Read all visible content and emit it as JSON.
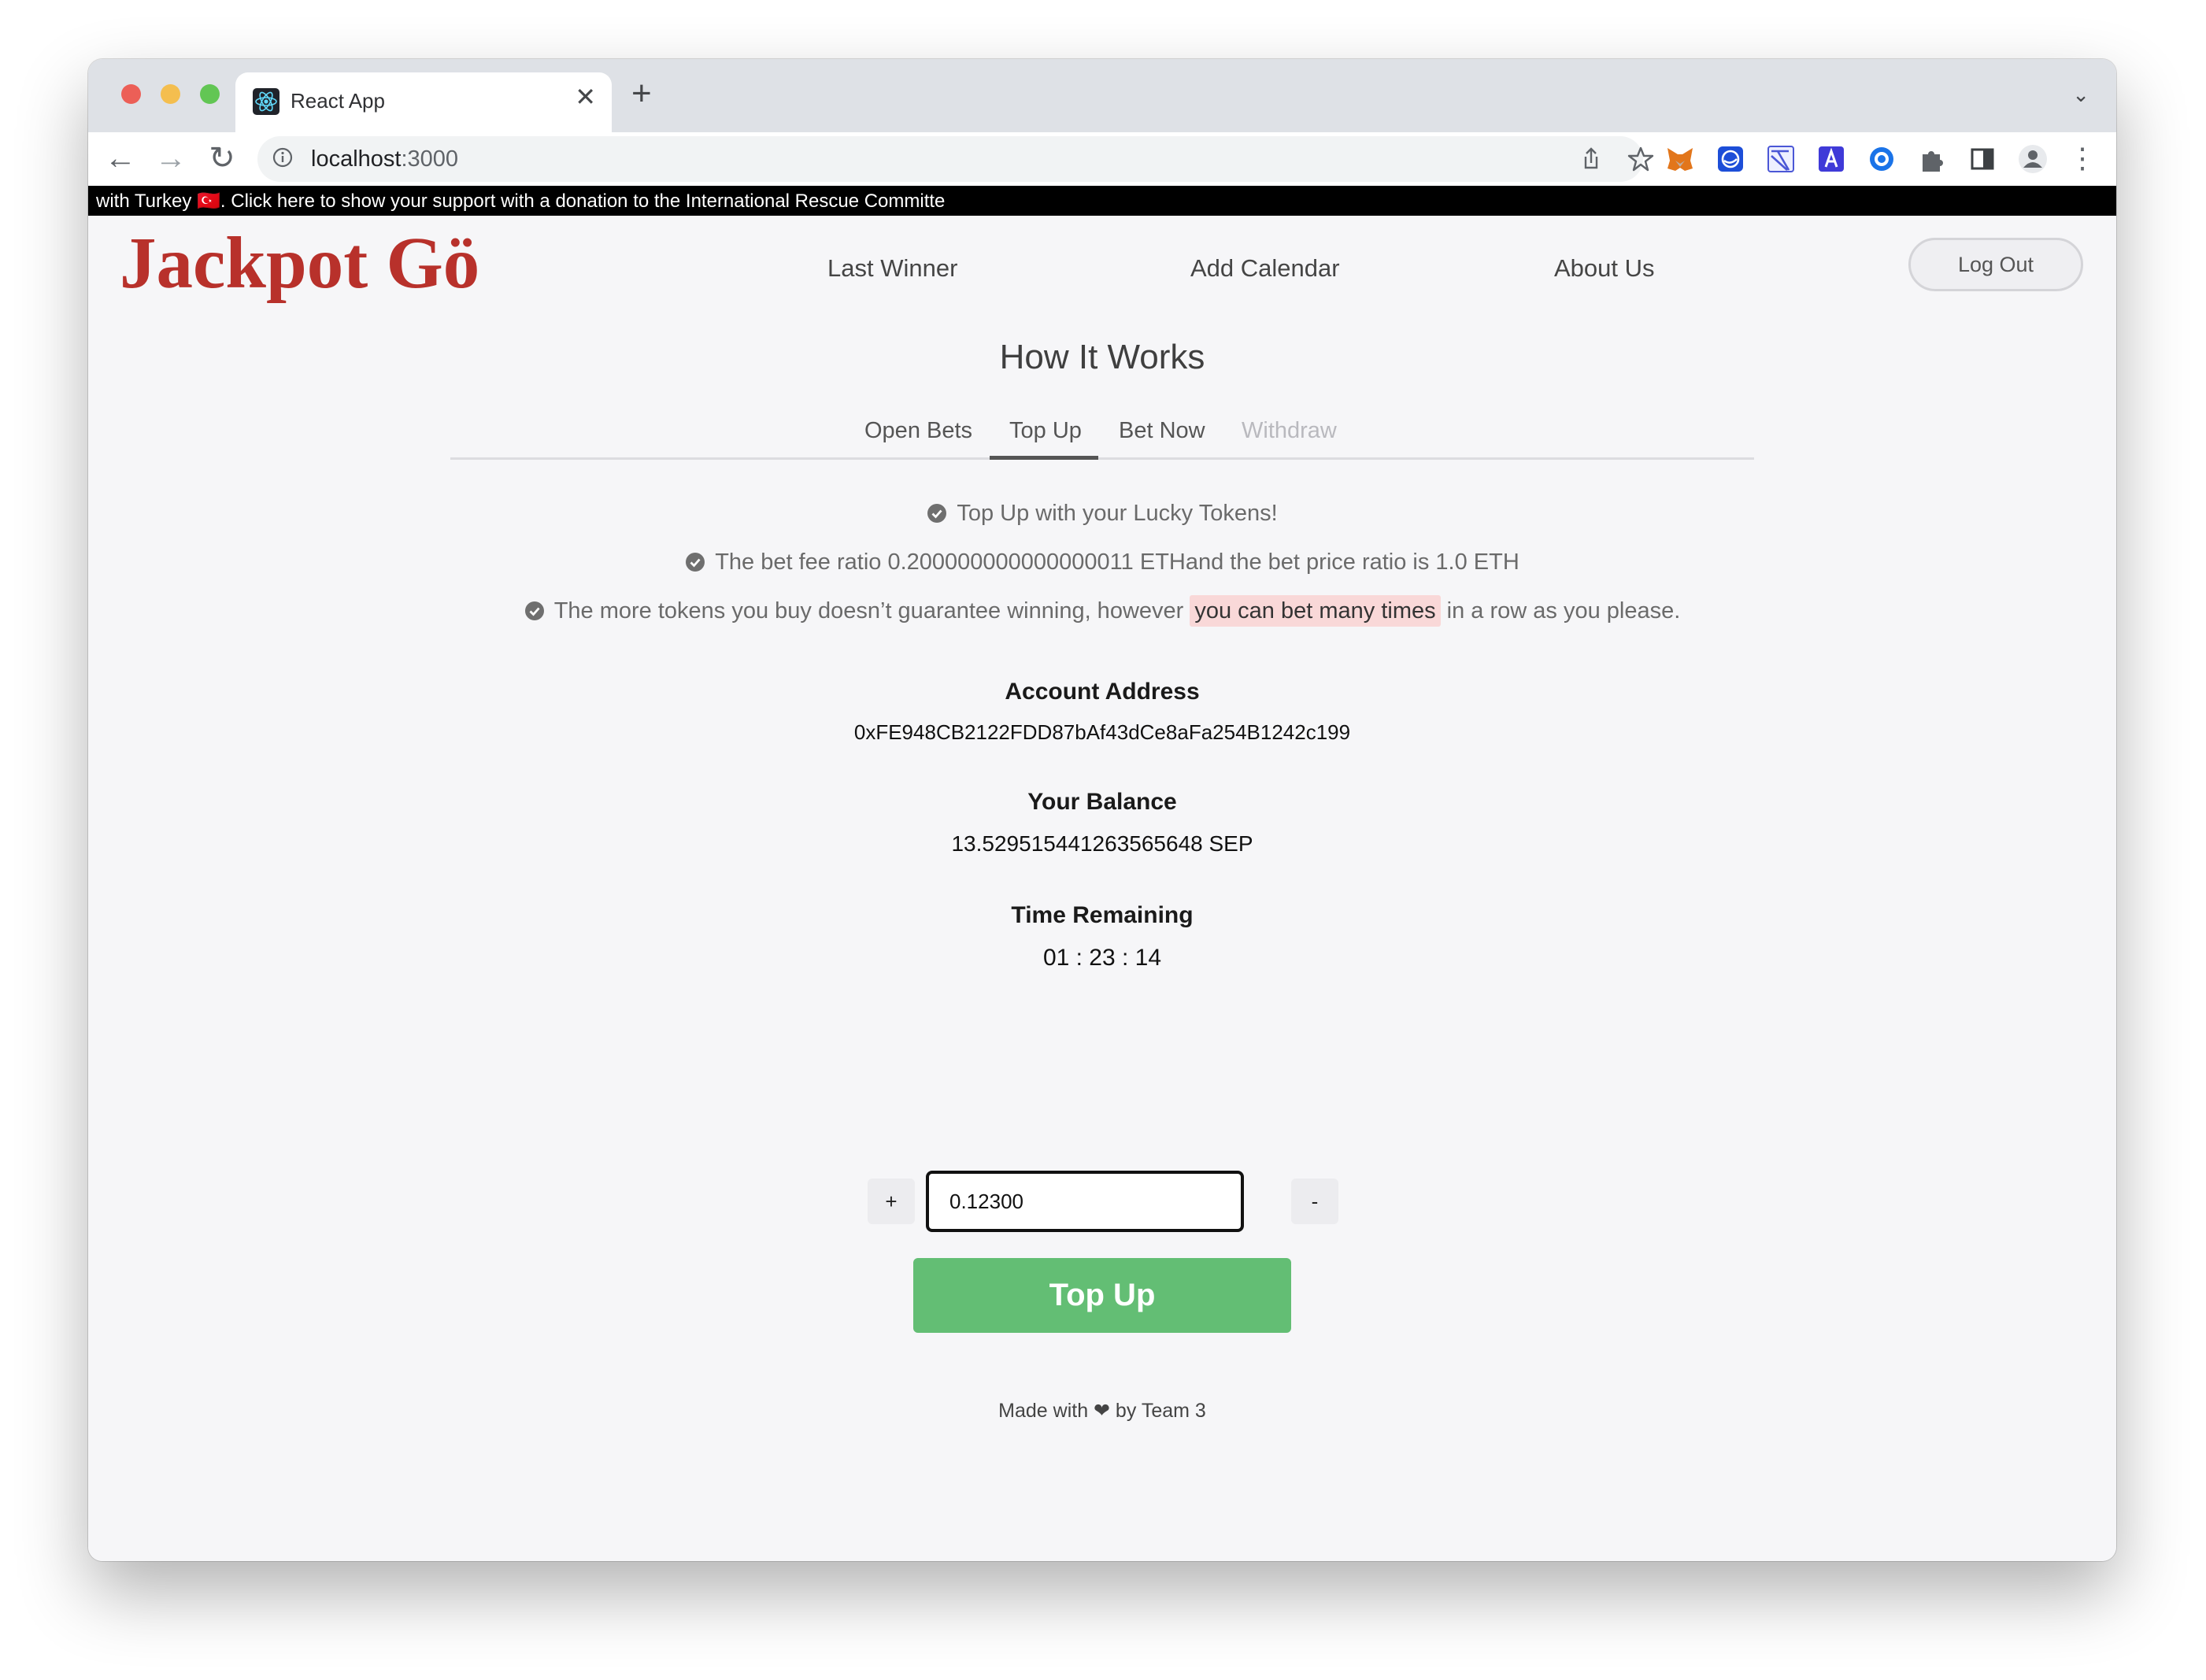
{
  "browser": {
    "tab_title": "React App",
    "tab_close": "✕",
    "new_tab": "+",
    "tab_list": "⌄",
    "url_host": "localhost",
    "url_port": ":3000",
    "nav_back": "←",
    "nav_forward": "→",
    "nav_reload": "↻",
    "menu": "⋮"
  },
  "ticker": {
    "text": "with Turkey 🇹🇷. Click here to show your support with a donation to the International Rescue Committe"
  },
  "header": {
    "logo": "Jackpot Gö",
    "nav": [
      "Last Winner",
      "Add Calendar",
      "About Us"
    ],
    "logout_label": "Log Out"
  },
  "main": {
    "title": "How It Works",
    "tabs": [
      "Open Bets",
      "Top Up",
      "Bet Now",
      "Withdraw"
    ],
    "active_tab": "Top Up",
    "features": {
      "line1": "Top Up with your Lucky Tokens!",
      "line2": "The bet fee ratio 0.200000000000000011 ETHand the bet price ratio is 1.0 ETH",
      "line3_before": "The more tokens you buy doesn’t guarantee winning, however ",
      "line3_highlight": "you can bet many times",
      "line3_after": " in a row as you please."
    },
    "account": {
      "label": "Account Address",
      "value": "0xFE948CB2122FDD87bAf43dCe8aFa254B1242c199"
    },
    "balance": {
      "label": "Your Balance",
      "value": "13.529515441263565648 SEP"
    },
    "time": {
      "label": "Time Remaining",
      "value": "01 : 23 : 14"
    },
    "amount": {
      "plus": "+",
      "minus": "-",
      "value": "0.12300"
    },
    "topup_label": "Top Up"
  },
  "footer": {
    "text": "Made with ❤ by Team 3"
  },
  "colors": {
    "brand": "#b8312b",
    "button": "#63be74",
    "highlight": "#f9d8d8"
  }
}
